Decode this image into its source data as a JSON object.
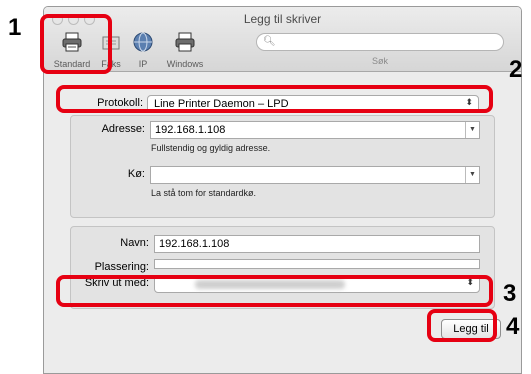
{
  "window": {
    "title": "Legg til skriver"
  },
  "toolbar": {
    "items": [
      {
        "label": "Standard",
        "icon": "printer-icon"
      },
      {
        "label": "Faks",
        "icon": "fax-icon"
      },
      {
        "label": "IP",
        "icon": "globe-icon"
      },
      {
        "label": "Windows",
        "icon": "windows-printer-icon"
      }
    ],
    "search_label": "Søk",
    "search_placeholder": ""
  },
  "form": {
    "protocol_label": "Protokoll:",
    "protocol_value": "Line Printer Daemon – LPD",
    "address_label": "Adresse:",
    "address_value": "192.168.1.108",
    "address_hint": "Fullstendig og gyldig adresse.",
    "queue_label": "Kø:",
    "queue_value": "",
    "queue_hint": "La stå tom for standardkø.",
    "name_label": "Navn:",
    "name_value": "192.168.1.108",
    "location_label": "Plassering:",
    "location_value": "",
    "print_with_label": "Skriv ut med:",
    "add_button": "Legg til"
  },
  "callouts": [
    "1",
    "2",
    "3",
    "4"
  ],
  "colors": {
    "callout": "#e60012",
    "window_bg": "#ececec"
  }
}
